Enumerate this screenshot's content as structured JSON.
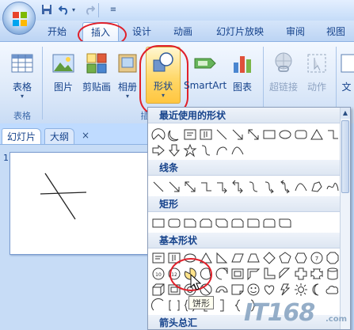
{
  "quick_access": {
    "save_icon": "save-icon",
    "undo_icon": "undo-icon",
    "redo_icon": "redo-icon",
    "customize_icon": "customize-qat-icon"
  },
  "tabs": [
    {
      "label": "开始"
    },
    {
      "label": "插入",
      "active": true
    },
    {
      "label": "设计"
    },
    {
      "label": "动画"
    },
    {
      "label": "幻灯片放映"
    },
    {
      "label": "审阅"
    },
    {
      "label": "视图"
    }
  ],
  "ribbon": {
    "table": {
      "label": "表格",
      "group": "表格"
    },
    "picture": {
      "label": "图片"
    },
    "clipart": {
      "label": "剪贴画"
    },
    "album": {
      "label": "相册"
    },
    "shapes": {
      "label": "形状"
    },
    "smartart": {
      "label": "SmartArt"
    },
    "chart": {
      "label": "图表"
    },
    "hyperlink": {
      "label": "超链接"
    },
    "action": {
      "label": "动作"
    },
    "textbox": {
      "label": "文"
    },
    "illustrations_group_partial": "插"
  },
  "slide_pane": {
    "tab_slides": "幻灯片",
    "tab_outline": "大纲",
    "close": "×",
    "slide_number": "1"
  },
  "gallery": {
    "recent": "最近使用的形状",
    "lines": "线条",
    "rect": "矩形",
    "basic": "基本形状",
    "arrows": "箭头总汇",
    "tooltip": "饼形"
  },
  "watermark": {
    "text": "IT168",
    "suffix": ".com"
  },
  "colors": {
    "accent": "#ffc640",
    "highlight_ring": "#e0202a",
    "ribbon_text": "#15428b"
  }
}
